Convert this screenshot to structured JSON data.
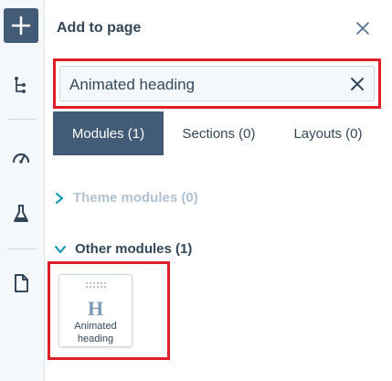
{
  "rail": {
    "items": [
      {
        "icon": "plus-icon"
      },
      {
        "icon": "tree-structure-icon"
      },
      {
        "icon": "speedometer-icon"
      },
      {
        "icon": "flask-icon"
      },
      {
        "icon": "page-icon"
      }
    ]
  },
  "panel": {
    "title": "Add to page",
    "close_icon": "close-icon"
  },
  "search": {
    "value": "Animated heading",
    "clear_icon": "clear-icon"
  },
  "tabs": [
    {
      "label": "Modules (1)",
      "active": true
    },
    {
      "label": "Sections (0)",
      "active": false
    },
    {
      "label": "Layouts (0)",
      "active": false
    }
  ],
  "sections": {
    "theme": {
      "label": "Theme modules (0)",
      "expanded": false
    },
    "other": {
      "label": "Other modules (1)",
      "expanded": true
    }
  },
  "module": {
    "icon_letter": "H",
    "label": "Animated heading"
  },
  "colors": {
    "accent": "#425b76",
    "highlight": "#e01e2a",
    "text": "#33475b",
    "muted": "#b0c1d4",
    "link": "#0091ae"
  }
}
